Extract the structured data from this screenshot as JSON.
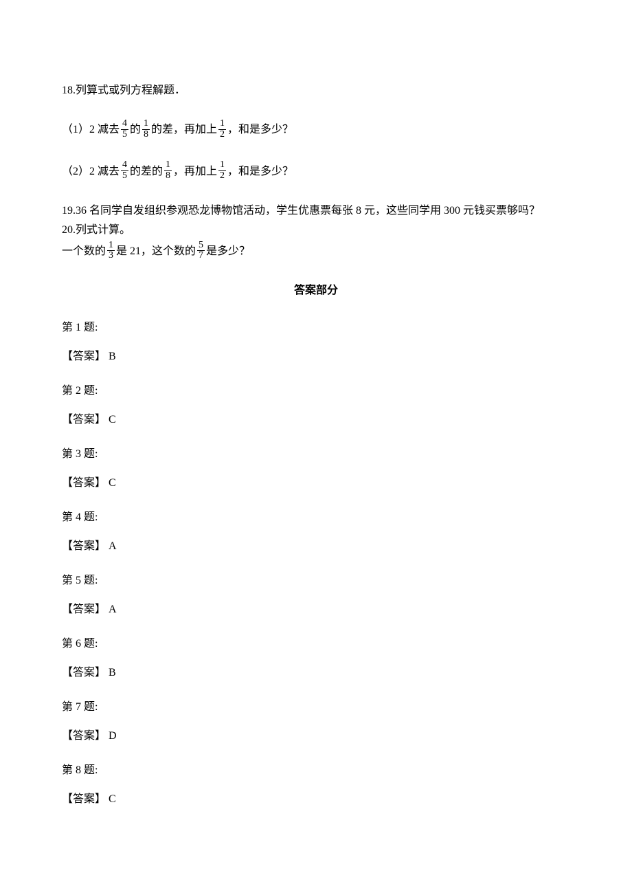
{
  "q18": {
    "title": "18.列算式或列方程解题．",
    "sub1_pre": "（1）2 减去 ",
    "sub1_f1_num": "4",
    "sub1_f1_den": "5",
    "sub1_mid1": "的 ",
    "sub1_f2_num": "1",
    "sub1_f2_den": "8",
    "sub1_mid2": "的差，再加上 ",
    "sub1_f3_num": "1",
    "sub1_f3_den": "2",
    "sub1_post": "，和是多少？",
    "sub2_pre": "（2）2 减去 ",
    "sub2_f1_num": "4",
    "sub2_f1_den": "5",
    "sub2_mid1": "的差的 ",
    "sub2_f2_num": "1",
    "sub2_f2_den": "8",
    "sub2_mid2": "，再加上 ",
    "sub2_f3_num": "1",
    "sub2_f3_den": "2",
    "sub2_post": "，和是多少？"
  },
  "q19": "19.36 名同学自发组织参观恐龙博物馆活动，学生优惠票每张 8 元，这些同学用 300 元钱买票够吗？",
  "q20": {
    "title": "20.列式计算。",
    "pre": "一个数的 ",
    "f1_num": "1",
    "f1_den": "3",
    "mid1": "是 21，这个数的 ",
    "f2_num": "5",
    "f2_den": "7",
    "post": "是多少？"
  },
  "answers_header": "答案部分",
  "answers": [
    {
      "q": "第 1 题:",
      "a": "【答案】 B"
    },
    {
      "q": "第 2 题:",
      "a": "【答案】 C"
    },
    {
      "q": "第 3 题:",
      "a": "【答案】 C"
    },
    {
      "q": "第 4 题:",
      "a": "【答案】 A"
    },
    {
      "q": "第 5 题:",
      "a": "【答案】 A"
    },
    {
      "q": "第 6 题:",
      "a": "【答案】 B"
    },
    {
      "q": "第 7 题:",
      "a": "【答案】 D"
    },
    {
      "q": "第 8 题:",
      "a": "【答案】 C"
    }
  ]
}
